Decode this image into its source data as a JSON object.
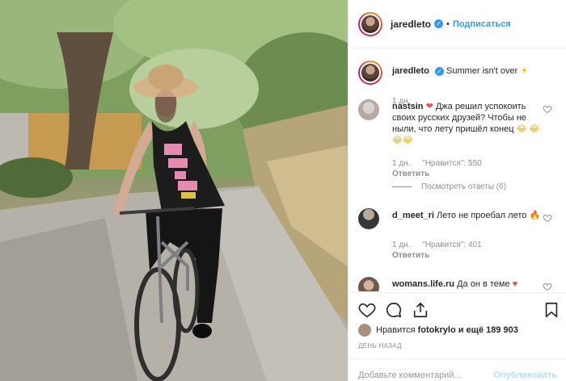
{
  "header": {
    "username": "jaredleto",
    "follow_label": "Подписаться"
  },
  "caption": {
    "username": "jaredleto",
    "text": "Summer isn't over",
    "emoji": "☀",
    "time": "1 дн."
  },
  "comments": [
    {
      "username": "nastsin",
      "text": "Джа решил успокоить своих русских друзей? Чтобы не ныли, что лету пришёл конец",
      "emoji_tail": "😂 😂😂😂",
      "time": "1 дн.",
      "likes": "\"Нравится\": 550",
      "reply_label": "Ответить",
      "see_replies": "Посмотреть ответы (6)"
    },
    {
      "username": "d_meet_ri",
      "text": "Лето не проебал лето",
      "emoji_tail": "🔥",
      "time": "1 дн.",
      "likes": "\"Нравится\": 401",
      "reply_label": "Ответить"
    },
    {
      "username": "womans.life.ru",
      "text": "Да он в теме",
      "emoji_tail": "♥"
    }
  ],
  "likes": {
    "prefix": "Нравится",
    "user": "fotokrylo",
    "suffix": "и ещё 189 903"
  },
  "date": "ДЕНЬ НАЗАД",
  "add_comment": {
    "placeholder": "Добавьте комментарий...",
    "publish_label": "Опубликовать"
  },
  "colors": {
    "accent": "#3897f0",
    "like_red": "#ed4956",
    "secondary_text": "#8e8e8e",
    "publish_disabled": "#b2dffc"
  },
  "icons": {
    "verified": "verified-badge-icon",
    "like": "heart-icon",
    "comment": "comment-bubble-icon",
    "share": "share-arrow-icon",
    "save": "bookmark-icon"
  }
}
